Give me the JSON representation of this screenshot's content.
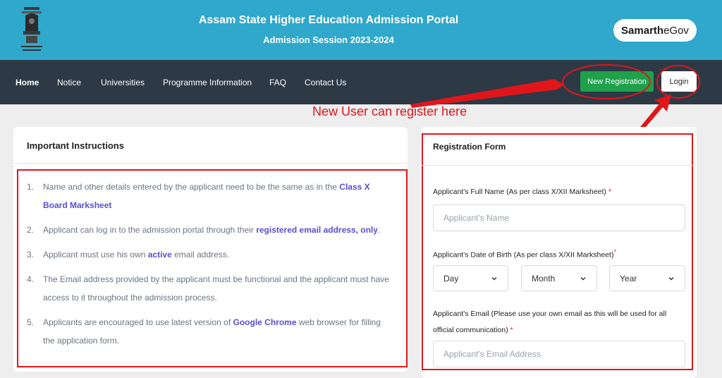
{
  "header": {
    "title": "Assam State Higher Education Admission Portal",
    "session": "Admission Session 2023-2024",
    "emblem_icon": "state-emblem-icon",
    "badge_bold": "Samarth",
    "badge_rest": "eGov"
  },
  "nav": {
    "items": [
      "Home",
      "Notice",
      "Universities",
      "Programme Information",
      "FAQ",
      "Contact Us"
    ],
    "register_label": "New Registration",
    "login_label": "Login"
  },
  "annotation": {
    "text": "New User can register here"
  },
  "instructions": {
    "title": "Important Instructions",
    "items": [
      {
        "num": "1.",
        "before": "Name and other details entered by the applicant need to be the same as in the ",
        "highlight": "Class X Board Marksheet",
        "after": ""
      },
      {
        "num": "2.",
        "before": "Applicant can log in to the admission portal through their ",
        "highlight": "registered email address, only",
        "after": "."
      },
      {
        "num": "3.",
        "before": "Applicant must use his own ",
        "highlight": "active",
        "after": " email address."
      },
      {
        "num": "4.",
        "before": "The Email address provided by the applicant must be functional and the applicant must have access to it throughout the admission process.",
        "highlight": "",
        "after": ""
      },
      {
        "num": "5.",
        "before": "Applicants are encouraged to use latest version of ",
        "highlight": "Google Chrome",
        "after": " web browser for filling the application form."
      }
    ]
  },
  "form": {
    "title": "Registration Form",
    "name_label": "Applicant's Full Name (As per class X/XII Marksheet)",
    "name_placeholder": "Applicant's Name",
    "dob_label": "Applicant's Date of Birth (As per class X/XII Marksheet)",
    "day_value": "Day",
    "month_value": "Month",
    "year_value": "Year",
    "email_label": "Applicant's Email (Please use your own email as this will be used for all official communication)",
    "email_placeholder": "Applicant's Email Address",
    "required_mark": "*"
  },
  "colors": {
    "header_bg": "#2fa8cc",
    "nav_bg": "#2d3945",
    "register_green": "#1fa04b",
    "highlight_purple": "#5a4ed1",
    "annotation_red": "#e0161b"
  }
}
